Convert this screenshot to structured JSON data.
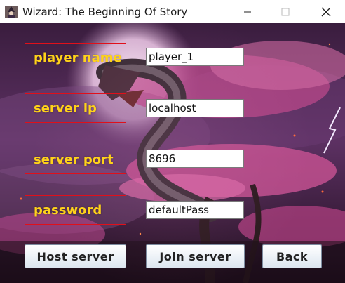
{
  "window": {
    "title": "Wizard: The Beginning Of Story",
    "app_icon": "wizard-icon",
    "controls": {
      "minimize_icon": "minimize-icon",
      "maximize_icon": "maximize-icon",
      "close_icon": "close-icon"
    }
  },
  "form": {
    "player_name": {
      "label": "player name",
      "value": "player_1"
    },
    "server_ip": {
      "label": "server ip",
      "value": "localhost"
    },
    "server_port": {
      "label": "server port",
      "value": "8696"
    },
    "password": {
      "label": "password",
      "value": "defaultPass"
    }
  },
  "buttons": {
    "host": "Host server",
    "join": "Join server",
    "back": "Back"
  },
  "colors": {
    "label_text": "#ffd21a",
    "label_border": "#e0101a",
    "sky": "#5a2e63",
    "blossom": "#c2508f"
  },
  "background": {
    "scene": "dragon-blossom-artwork"
  }
}
